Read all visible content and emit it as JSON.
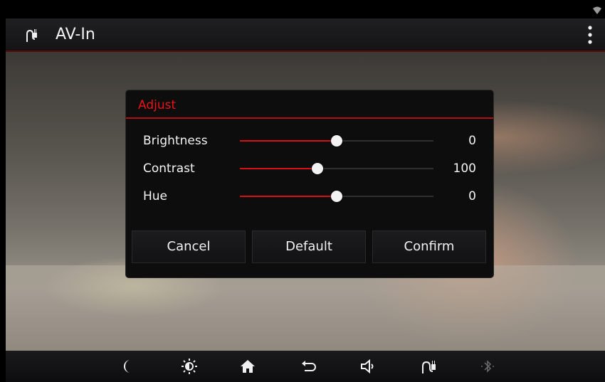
{
  "app_bar": {
    "title": "AV-In"
  },
  "dialog": {
    "title": "Adjust",
    "sliders": [
      {
        "label": "Brightness",
        "value": "0",
        "level": 0.5
      },
      {
        "label": "Contrast",
        "value": "100",
        "level": 0.4
      },
      {
        "label": "Hue",
        "value": "0",
        "level": 0.5
      }
    ],
    "buttons": {
      "cancel": "Cancel",
      "default": "Default",
      "confirm": "Confirm"
    }
  },
  "nav": [
    "moon-icon",
    "brightness-icon",
    "home-icon",
    "back-icon",
    "volume-icon",
    "av-in-icon",
    "bluetooth-icon"
  ],
  "colors": {
    "accent": "#d51016",
    "background": "#000000",
    "text": "#f4f4f4"
  }
}
